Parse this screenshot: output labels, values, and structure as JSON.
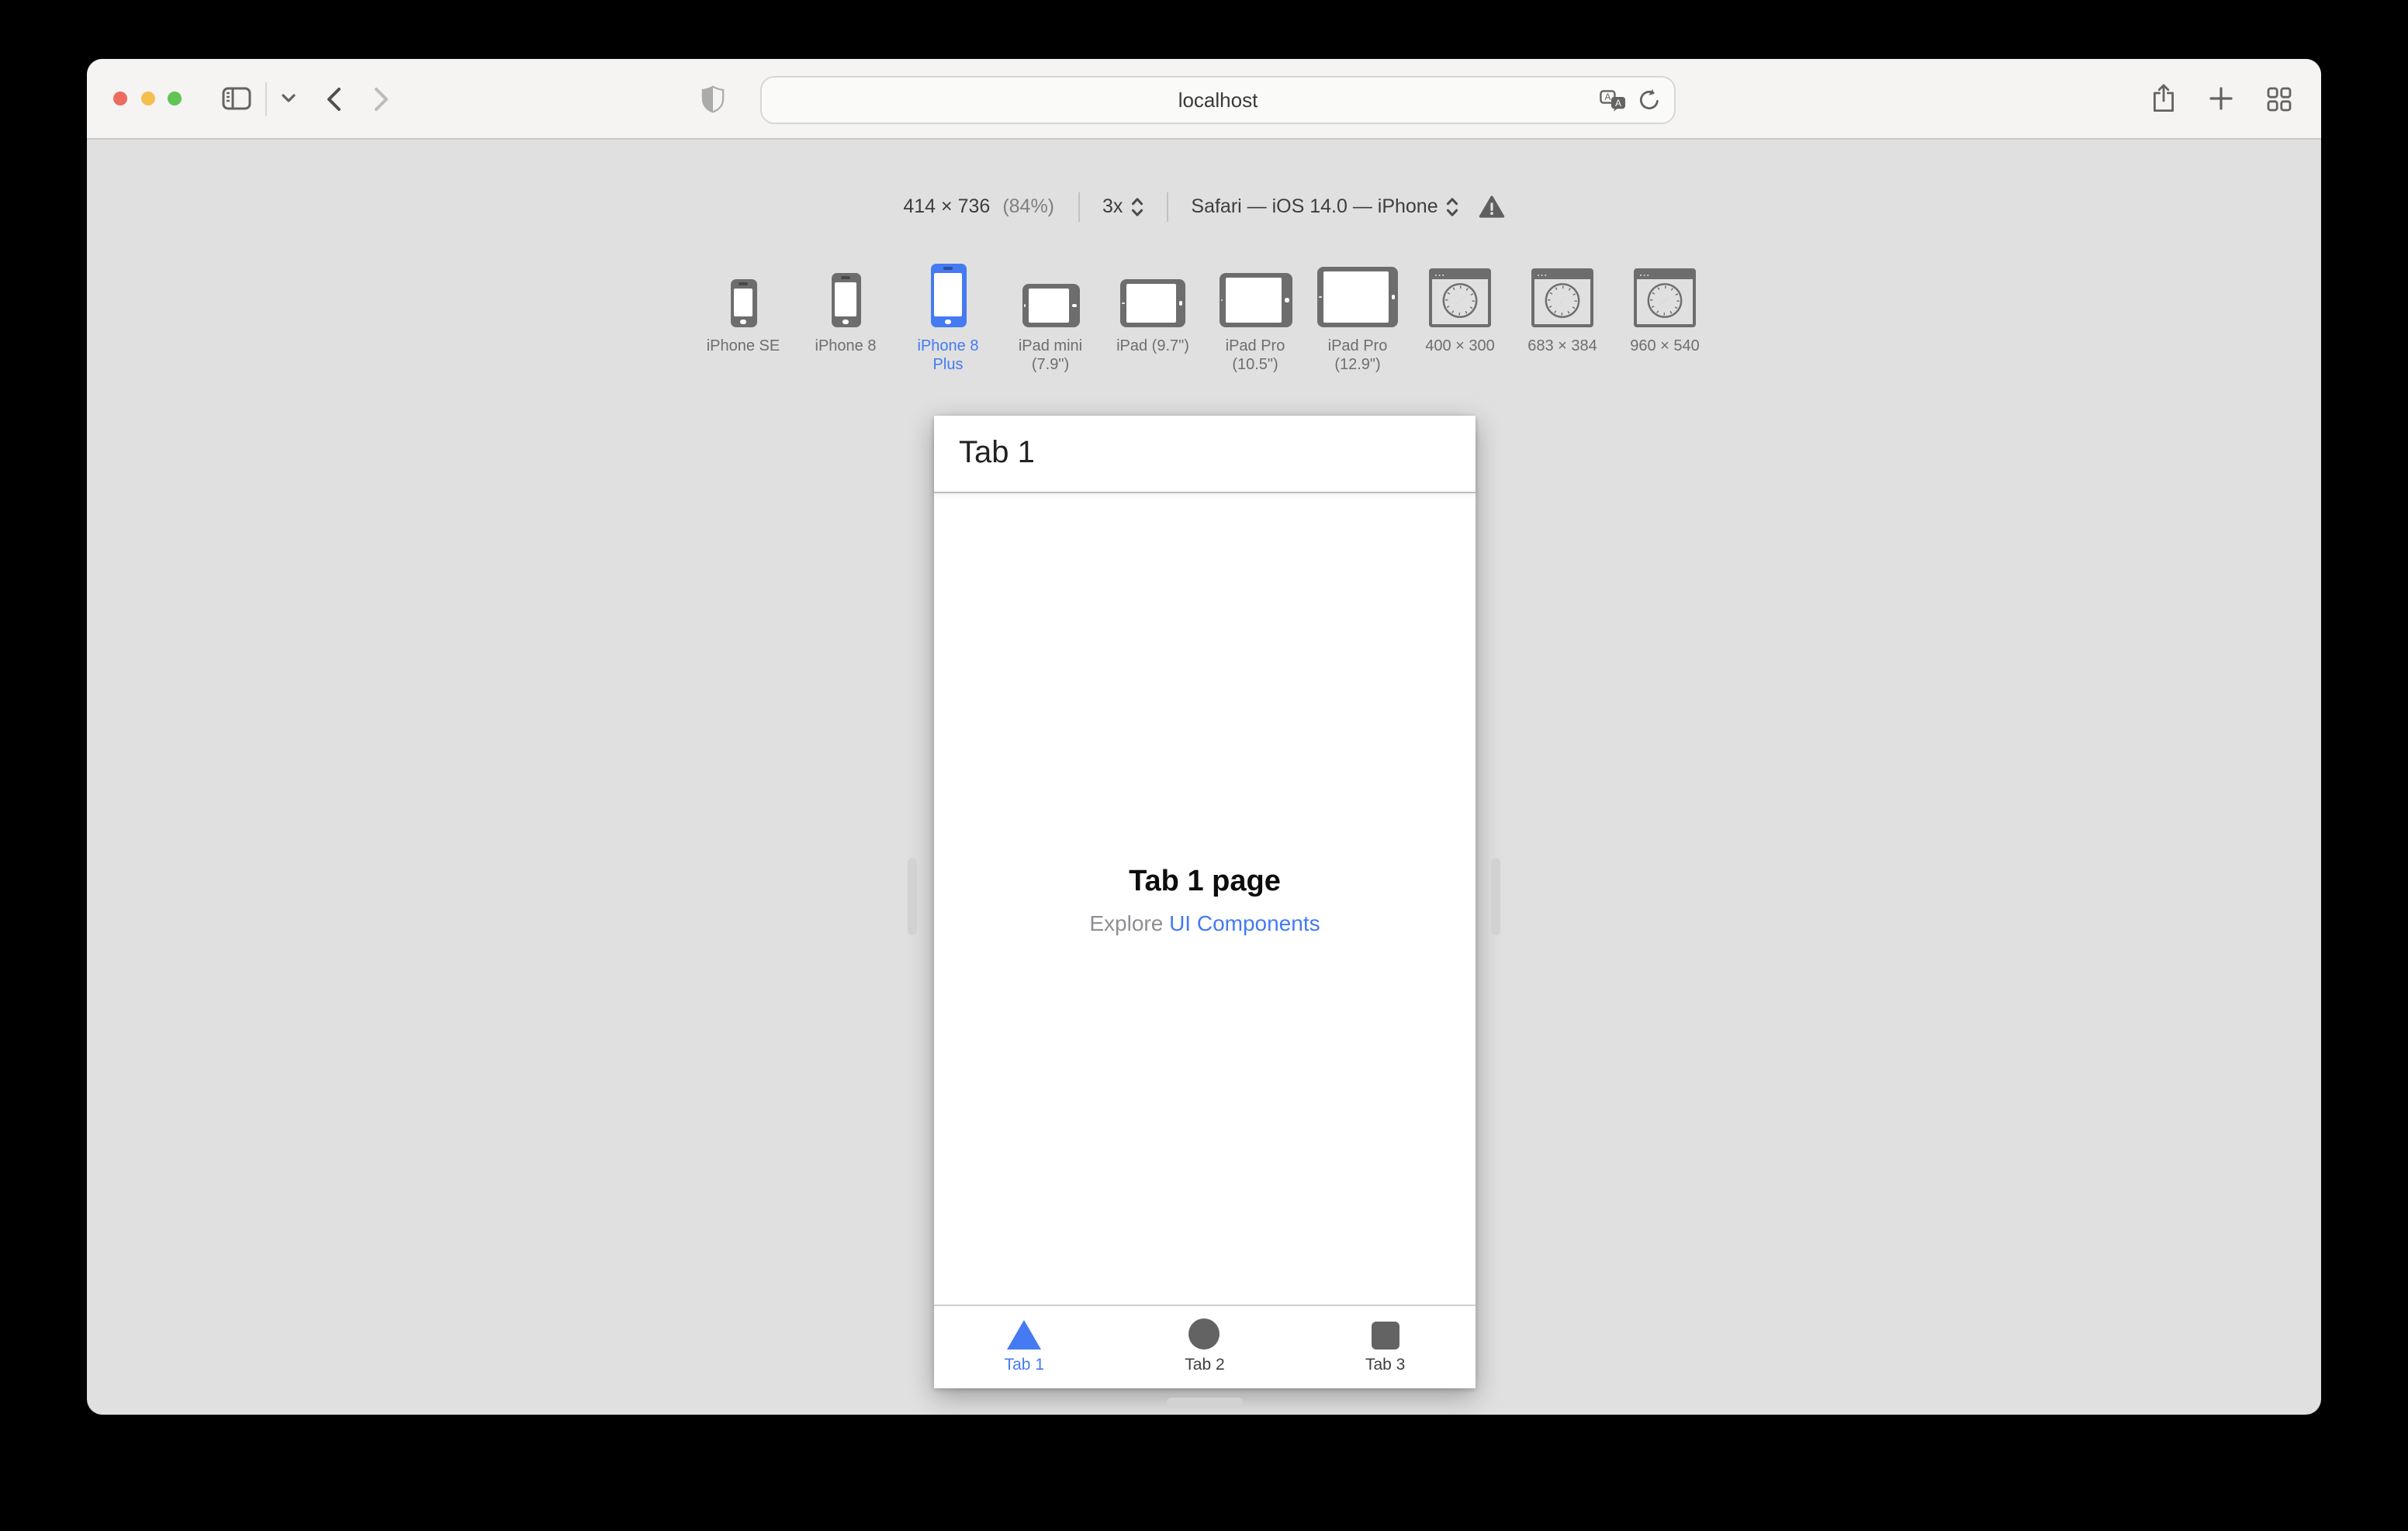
{
  "toolbar": {
    "url_value": "localhost"
  },
  "responsive_bar": {
    "dimensions": "414 × 736",
    "zoom_percent": "(84%)",
    "pixel_ratio": "3x",
    "user_agent": "Safari — iOS 14.0 — iPhone"
  },
  "device_presets": [
    {
      "label": "iPhone SE",
      "icon": "iphone-se",
      "selected": false
    },
    {
      "label": "iPhone 8",
      "icon": "iphone-8",
      "selected": false
    },
    {
      "label": "iPhone 8 Plus",
      "icon": "iphone-8-plus",
      "selected": true
    },
    {
      "label": "iPad mini (7.9\")",
      "icon": "ipad-mini",
      "selected": false
    },
    {
      "label": "iPad (9.7\")",
      "icon": "ipad",
      "selected": false
    },
    {
      "label": "iPad Pro (10.5\")",
      "icon": "ipad-pro-10",
      "selected": false
    },
    {
      "label": "iPad Pro (12.9\")",
      "icon": "ipad-pro-12",
      "selected": false
    },
    {
      "label": "400 × 300",
      "icon": "browser-window",
      "selected": false
    },
    {
      "label": "683 × 384",
      "icon": "browser-window",
      "selected": false
    },
    {
      "label": "960 × 540",
      "icon": "browser-window",
      "selected": false
    }
  ],
  "simulator": {
    "navbar_title": "Tab 1",
    "page_title": "Tab 1 page",
    "subtitle_prefix": "Explore ",
    "subtitle_link": "UI Components",
    "tabs": [
      {
        "label": "Tab 1",
        "icon": "triangle",
        "active": true
      },
      {
        "label": "Tab 2",
        "icon": "circle",
        "active": false
      },
      {
        "label": "Tab 3",
        "icon": "square",
        "active": false
      }
    ]
  },
  "colors": {
    "accent_blue": "#447af2",
    "traffic_red": "#ed6a5e",
    "traffic_yellow": "#f5bf4e",
    "traffic_green": "#61c454",
    "toolbar_bg": "#f5f4f3",
    "canvas_bg": "#e0e0e0",
    "device_icon_gray": "#6d6d6d"
  }
}
